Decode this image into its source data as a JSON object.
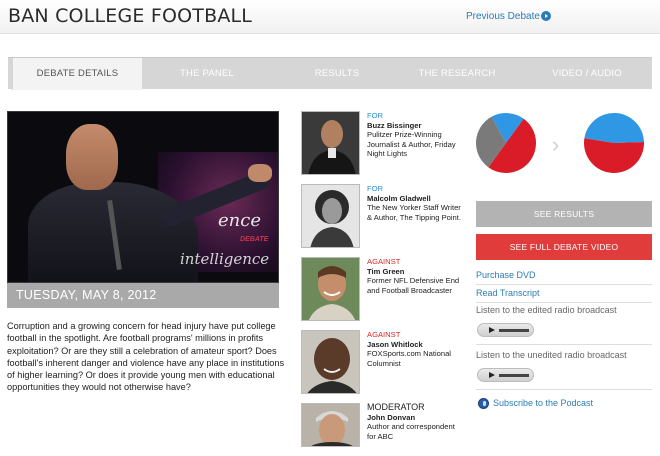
{
  "header": {
    "title": "BAN COLLEGE FOOTBALL",
    "prev_label": "Previous Debate"
  },
  "tabs": [
    {
      "label": "DEBATE DETAILS",
      "active": true
    },
    {
      "label": "THE PANEL",
      "active": false
    },
    {
      "label": "RESULTS",
      "active": false
    },
    {
      "label": "THE RESEARCH",
      "active": false
    },
    {
      "label": "VIDEO / AUDIO",
      "active": false
    }
  ],
  "video": {
    "logo_text": "intelligence",
    "logo_fragment": "ence",
    "logo_sub": "DEBATE",
    "date": "TUESDAY, MAY 8, 2012"
  },
  "description": "Corruption and a growing concern for head injury have put college football in the spotlight. Are football programs' millions in profits exploitation? Or are they still a celebration of amateur sport? Does football's inherent danger and violence have any place in institutions of higher learning? Or does it provide young men with educational opportunities they would not otherwise have?",
  "panel": [
    {
      "side": "FOR",
      "name": "Buzz Bissinger",
      "bio": "Pulitzer Prize-Winning Journalist & Author, Friday Night Lights"
    },
    {
      "side": "FOR",
      "name": "Malcolm Gladwell",
      "bio": "The New Yorker Staff Writer & Author, The Tipping Point."
    },
    {
      "side": "AGAINST",
      "name": "Tim Green",
      "bio": "Former NFL Defensive End and Football Broadcaster"
    },
    {
      "side": "AGAINST",
      "name": "Jason Whitlock",
      "bio": "FOXSports.com National Columnist"
    },
    {
      "side": "MODERATOR",
      "name": "John Donvan",
      "bio": "Author and correspondent for ABC"
    }
  ],
  "results": {
    "colors": {
      "for": "#2f97e3",
      "against": "#d91c27",
      "undecided": "#7a7a7a"
    },
    "before": {
      "for": 0.18,
      "against": 0.5,
      "undecided": 0.32
    },
    "after": {
      "for": 0.47,
      "against": 0.53,
      "undecided": 0.0
    }
  },
  "sidebar": {
    "see_results": "SEE RESULTS",
    "see_video": "SEE FULL DEBATE VIDEO",
    "purchase_dvd": "Purchase DVD",
    "read_transcript": "Read Transcript",
    "edited_label": "Listen to the edited radio broadcast",
    "unedited_label": "Listen to the unedited radio broadcast",
    "podcast": "Subscribe to the Podcast"
  }
}
